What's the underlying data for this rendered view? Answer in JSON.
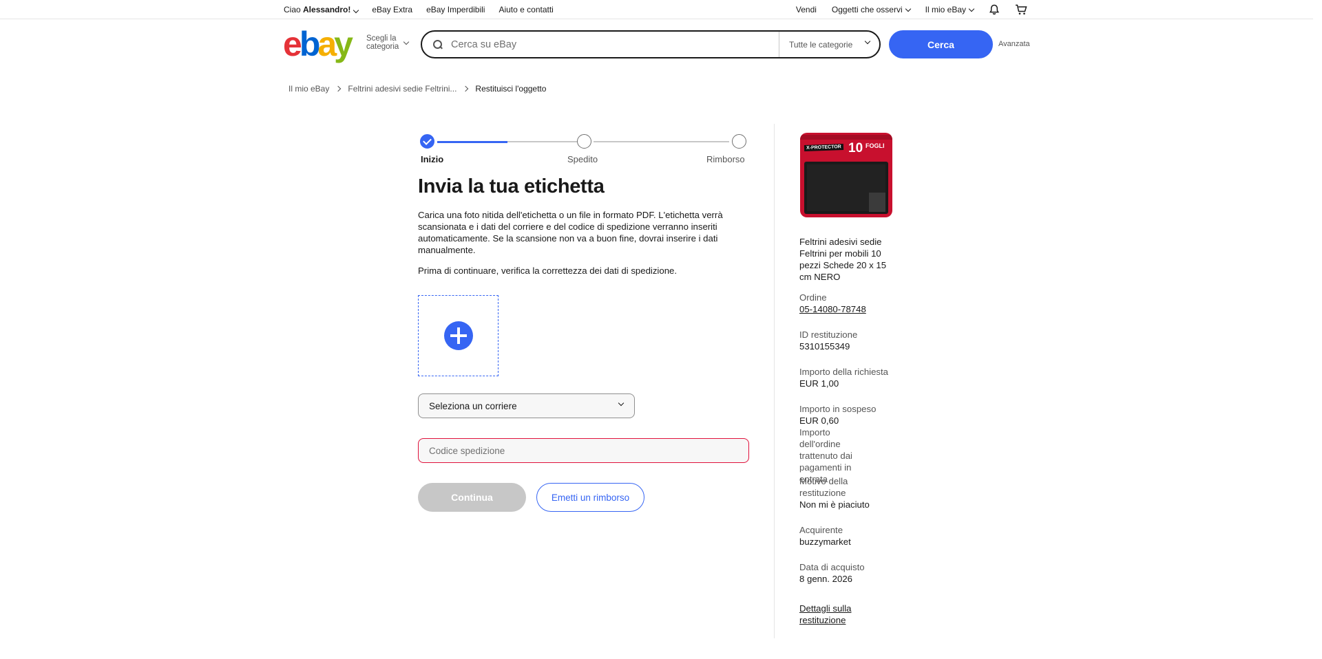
{
  "topbar": {
    "greeting_prefix": "Ciao ",
    "greeting_name": "Alessandro!",
    "links": [
      "eBay Extra",
      "eBay Imperdibili",
      "Aiuto e contatti"
    ],
    "sell": "Vendi",
    "watchlist": "Oggetti che osservi",
    "my_ebay": "Il mio eBay"
  },
  "header": {
    "logo": [
      "e",
      "b",
      "a",
      "y"
    ],
    "choose_category": [
      "Scegli la",
      "categoria"
    ],
    "search_placeholder": "Cerca su eBay",
    "category_select": "Tutte le categorie",
    "search_button": "Cerca",
    "advanced": "Avanzata"
  },
  "breadcrumb": {
    "items": [
      "Il mio eBay",
      "Feltrini adesivi sedie Feltrini...",
      "Restituisci l'oggetto"
    ]
  },
  "stepper": {
    "steps": [
      "Inizio",
      "Spedito",
      "Rimborso"
    ],
    "progress_fraction": 0.5
  },
  "main": {
    "title": "Invia la tua etichetta",
    "description": "Carica una foto nitida dell'etichetta o un file in formato PDF. L'etichetta verrà scansionata e i dati del corriere e del codice di spedizione verranno inseriti automaticamente. Se la scansione non va a buon fine, dovrai inserire i dati manualmente.",
    "verify": "Prima di continuare, verifica la correttezza dei dati di spedizione.",
    "carrier_select": "Seleziona un corriere",
    "tracking_placeholder": "Codice spedizione",
    "continue_button": "Continua",
    "refund_button": "Emetti un rimborso"
  },
  "sidebar": {
    "product_image_text": {
      "brand": "X-PROTECTOR",
      "count": "10",
      "unit": "FOGLI"
    },
    "product_title": "Feltrini adesivi sedie Feltrini per mobili 10 pezzi Schede 20 x 15 cm NERO",
    "order_label": "Ordine",
    "order_value": "05-14080-78748",
    "return_id_label": "ID restituzione",
    "return_id_value": "5310155349",
    "request_amount_label": "Importo della richiesta",
    "request_amount_value": "EUR 1,00",
    "pending_amount_label": "Importo in sospeso",
    "pending_amount_value": "EUR 0,60",
    "pending_note": "Importo dell'ordine trattenuto dai pagamenti in entrata",
    "reason_label": "Motivo della restituzione",
    "reason_value": "Non mi è piaciuto",
    "buyer_label": "Acquirente",
    "buyer_value": "buzzymarket",
    "purchase_date_label": "Data di acquisto",
    "purchase_date_value": "8 genn. 2026",
    "details_link": "Dettagli sulla restituzione"
  },
  "colors": {
    "accent": "#3665f3",
    "error": "#e0103a",
    "disabled": "#c7c7c7"
  }
}
